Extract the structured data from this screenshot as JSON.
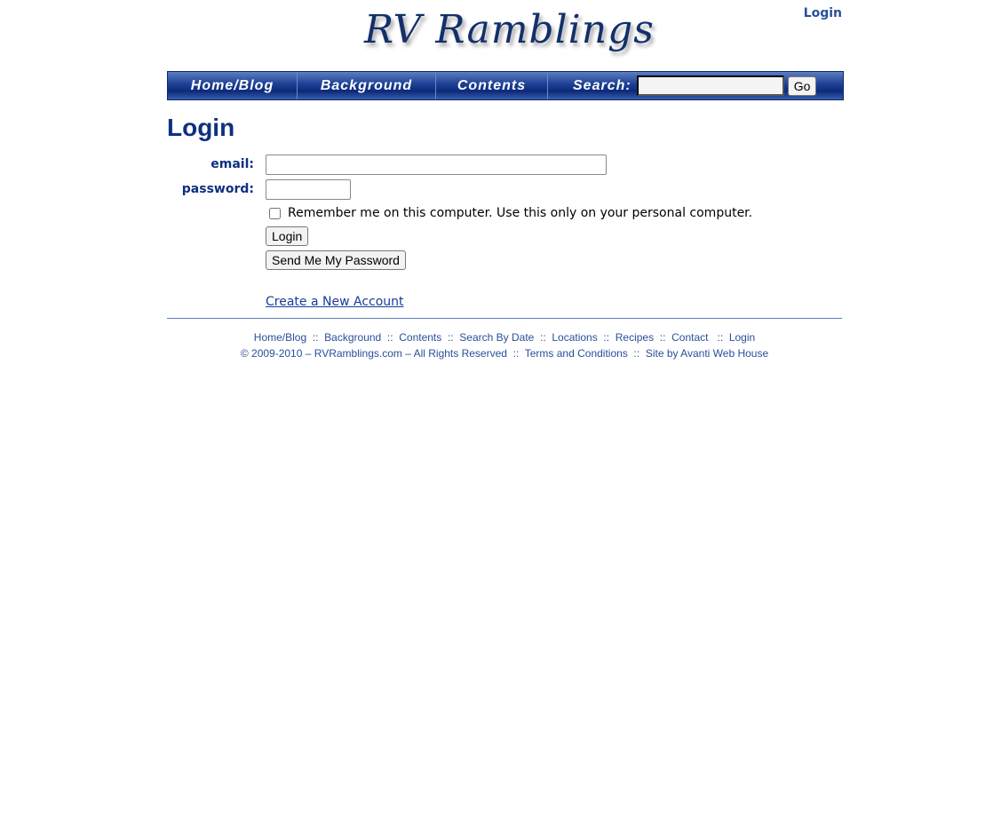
{
  "header": {
    "logo": "RV Ramblings",
    "login_link": "Login"
  },
  "nav": {
    "items": [
      "Home/Blog",
      "Background",
      "Contents"
    ],
    "search_label": "Search:",
    "search_value": "",
    "go": "Go"
  },
  "page": {
    "title": "Login",
    "email_label": "email:",
    "email_value": "",
    "password_label": "password:",
    "password_value": "",
    "remember": "Remember me on this computer. Use this only on your personal computer.",
    "remember_checked": false,
    "login_button": "Login",
    "send_password_button": "Send Me My Password",
    "create_account": "Create a New Account"
  },
  "footer": {
    "links": [
      "Home/Blog",
      "Background",
      "Contents",
      "Search By Date",
      "Locations",
      "Recipes",
      "Contact",
      "Login"
    ],
    "copyright": "© 2009-2010 – RVRamblings.com – All Rights Reserved",
    "terms": "Terms and Conditions",
    "credit": "Site by Avanti Web House",
    "separator": "::"
  }
}
